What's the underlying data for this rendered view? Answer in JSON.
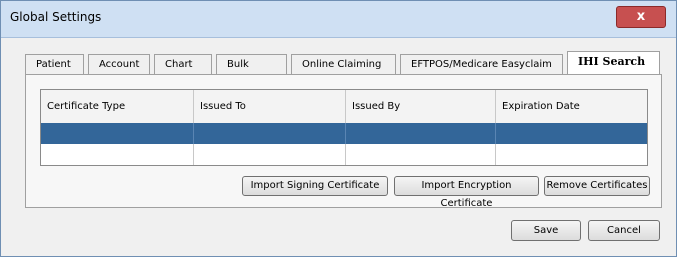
{
  "window": {
    "title": "Global Settings",
    "close_label": "x"
  },
  "tabs": [
    {
      "label": "Patient",
      "active": false
    },
    {
      "label": "Account",
      "active": false
    },
    {
      "label": "Chart No",
      "active": false
    },
    {
      "label": "Bulk Billing",
      "active": false
    },
    {
      "label": "Online Claiming",
      "active": false
    },
    {
      "label": "EFTPOS/Medicare Easyclaim",
      "active": false
    },
    {
      "label": "IHI Search",
      "active": true
    }
  ],
  "table": {
    "columns": [
      "Certificate Type",
      "Issued To",
      "Issued By",
      "Expiration Date"
    ],
    "rows": [
      {
        "selected": true,
        "cells": [
          "",
          "",
          "",
          ""
        ]
      },
      {
        "selected": false,
        "cells": [
          "",
          "",
          "",
          ""
        ]
      }
    ]
  },
  "panel_buttons": {
    "import_signing": "Import Signing Certificate",
    "import_encryption": "Import Encryption Certificate",
    "remove": "Remove Certificates"
  },
  "footer_buttons": {
    "save": "Save",
    "cancel": "Cancel"
  },
  "colors": {
    "selected_row": "#336699",
    "close_button": "#c75050"
  }
}
